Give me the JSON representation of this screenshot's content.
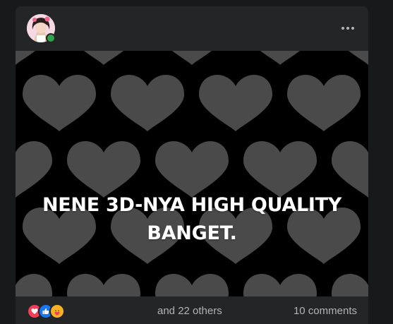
{
  "post": {
    "text_line1": "NENE 3D-NYA HIGH QUALITY",
    "text_line2": "BANGET.",
    "reactions_label": "and 22 others",
    "comments_label": "10 comments",
    "reaction_types": [
      "love-icon",
      "like-icon",
      "care-icon"
    ]
  },
  "colors": {
    "background": "#18191a",
    "card": "#242526",
    "image_bg": "#000000",
    "heart": "#4a4a4a",
    "secondary_text": "#b0b3b8",
    "online": "#31a24c"
  }
}
